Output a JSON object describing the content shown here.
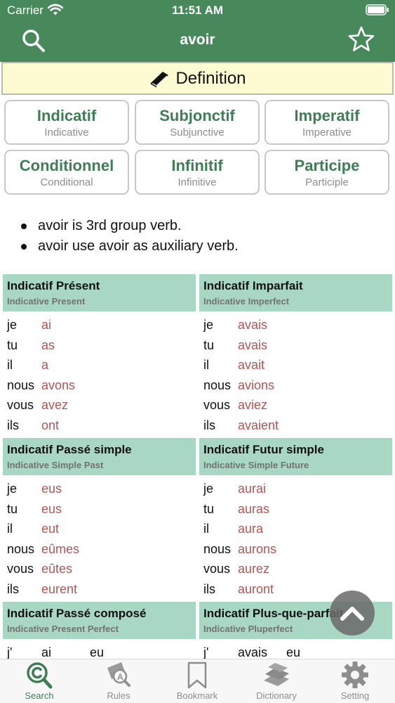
{
  "status_bar": {
    "carrier": "Carrier",
    "time": "11:51 AM"
  },
  "nav": {
    "title": "avoir",
    "left_icon": "search-icon",
    "right_icon": "star-icon"
  },
  "definition": {
    "label": "Definition",
    "icon": "book-icon"
  },
  "moods": [
    {
      "main": "Indicatif",
      "sub": "Indicative"
    },
    {
      "main": "Subjonctif",
      "sub": "Subjunctive"
    },
    {
      "main": "Imperatif",
      "sub": "Imperative"
    },
    {
      "main": "Conditionnel",
      "sub": "Conditional"
    },
    {
      "main": "Infinitif",
      "sub": "Infinitive"
    },
    {
      "main": "Participe",
      "sub": "Participle"
    }
  ],
  "notes": [
    "avoir is 3rd group verb.",
    "avoir use avoir as auxiliary verb."
  ],
  "conjugations": {
    "present": {
      "title": "Indicatif Présent",
      "subtitle": "Indicative Present",
      "rows": [
        {
          "pron": "je",
          "form": "ai"
        },
        {
          "pron": "tu",
          "form": "as"
        },
        {
          "pron": "il",
          "form": "a"
        },
        {
          "pron": "nous",
          "form": "avons"
        },
        {
          "pron": "vous",
          "form": "avez"
        },
        {
          "pron": "ils",
          "form": "ont"
        }
      ]
    },
    "imparfait": {
      "title": "Indicatif Imparfait",
      "subtitle": "Indicative Imperfect",
      "rows": [
        {
          "pron": "je",
          "form": "avais"
        },
        {
          "pron": "tu",
          "form": "avais"
        },
        {
          "pron": "il",
          "form": "avait"
        },
        {
          "pron": "nous",
          "form": "avions"
        },
        {
          "pron": "vous",
          "form": "aviez"
        },
        {
          "pron": "ils",
          "form": "avaient"
        }
      ]
    },
    "passe_simple": {
      "title": "Indicatif Passé simple",
      "subtitle": "Indicative Simple Past",
      "rows": [
        {
          "pron": "je",
          "form": "eus"
        },
        {
          "pron": "tu",
          "form": "eus"
        },
        {
          "pron": "il",
          "form": "eut"
        },
        {
          "pron": "nous",
          "form": "eûmes"
        },
        {
          "pron": "vous",
          "form": "eûtes"
        },
        {
          "pron": "ils",
          "form": "eurent"
        }
      ]
    },
    "futur_simple": {
      "title": "Indicatif Futur simple",
      "subtitle": "Indicative Simple Future",
      "rows": [
        {
          "pron": "je",
          "form": "aurai"
        },
        {
          "pron": "tu",
          "form": "auras"
        },
        {
          "pron": "il",
          "form": "aura"
        },
        {
          "pron": "nous",
          "form": "aurons"
        },
        {
          "pron": "vous",
          "form": "aurez"
        },
        {
          "pron": "ils",
          "form": "auront"
        }
      ]
    },
    "passe_compose": {
      "title": "Indicatif Passé composé",
      "subtitle": "Indicative Present Perfect",
      "rows": [
        {
          "pron": "j'",
          "aux": "ai",
          "part": "eu"
        }
      ]
    },
    "plus_que_parfait": {
      "title": "Indicatif Plus-que-parfait",
      "subtitle": "Indicative Pluperfect",
      "rows": [
        {
          "pron": "j'",
          "aux": "avais",
          "part": "eu"
        }
      ]
    }
  },
  "tabs": [
    {
      "label": "Search",
      "icon": "search-copyright-icon",
      "active": true
    },
    {
      "label": "Rules",
      "icon": "rules-icon",
      "active": false
    },
    {
      "label": "Bookmark",
      "icon": "bookmark-icon",
      "active": false
    },
    {
      "label": "Dictionary",
      "icon": "dictionary-icon",
      "active": false
    },
    {
      "label": "Setting",
      "icon": "gear-icon",
      "active": false
    }
  ],
  "colors": {
    "header_green": "#47895a",
    "mood_green": "#3f7e55",
    "table_header": "#a8d7c4",
    "verb_form_red": "#b25555",
    "definition_bg": "#fdfbd2"
  }
}
